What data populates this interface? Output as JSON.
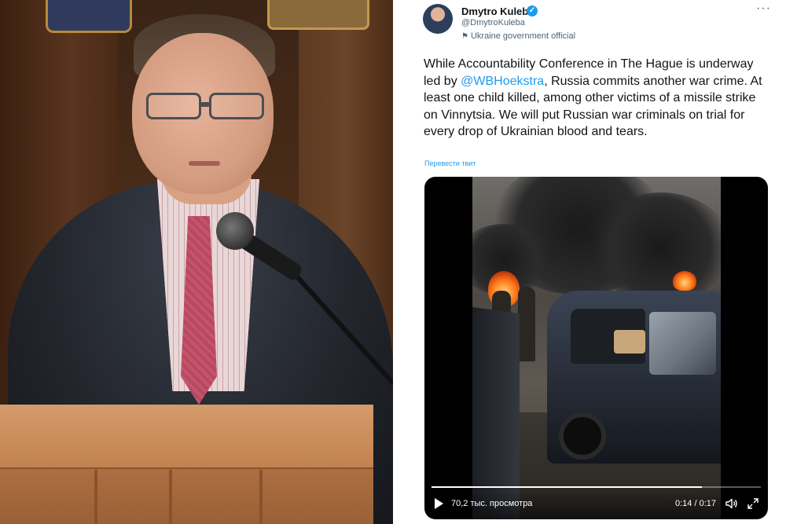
{
  "tweet": {
    "author_name": "Dmytro Kuleba",
    "author_handle": "@DmytroKuleba",
    "government_label": "Ukraine government official",
    "text_before_mention": "While Accountability Conference in The Hague is underway led by ",
    "mention": "@WBHoekstra",
    "text_after_mention": ", Russia commits another war crime. At least one child killed, among other victims of a missile strike on Vinnytsia. We will put Russian war criminals on trial for every drop of Ukrainian blood and tears.",
    "translate_link": "Перевести твит",
    "more_icon": "more-horizontal-icon"
  },
  "video": {
    "views": "70,2 тыс. просмотра",
    "time": "0:14 / 0:17",
    "progress": 0.82
  },
  "colors": {
    "accent": "#1d9bf0",
    "text": "#0f1419",
    "secondary": "#536471"
  }
}
